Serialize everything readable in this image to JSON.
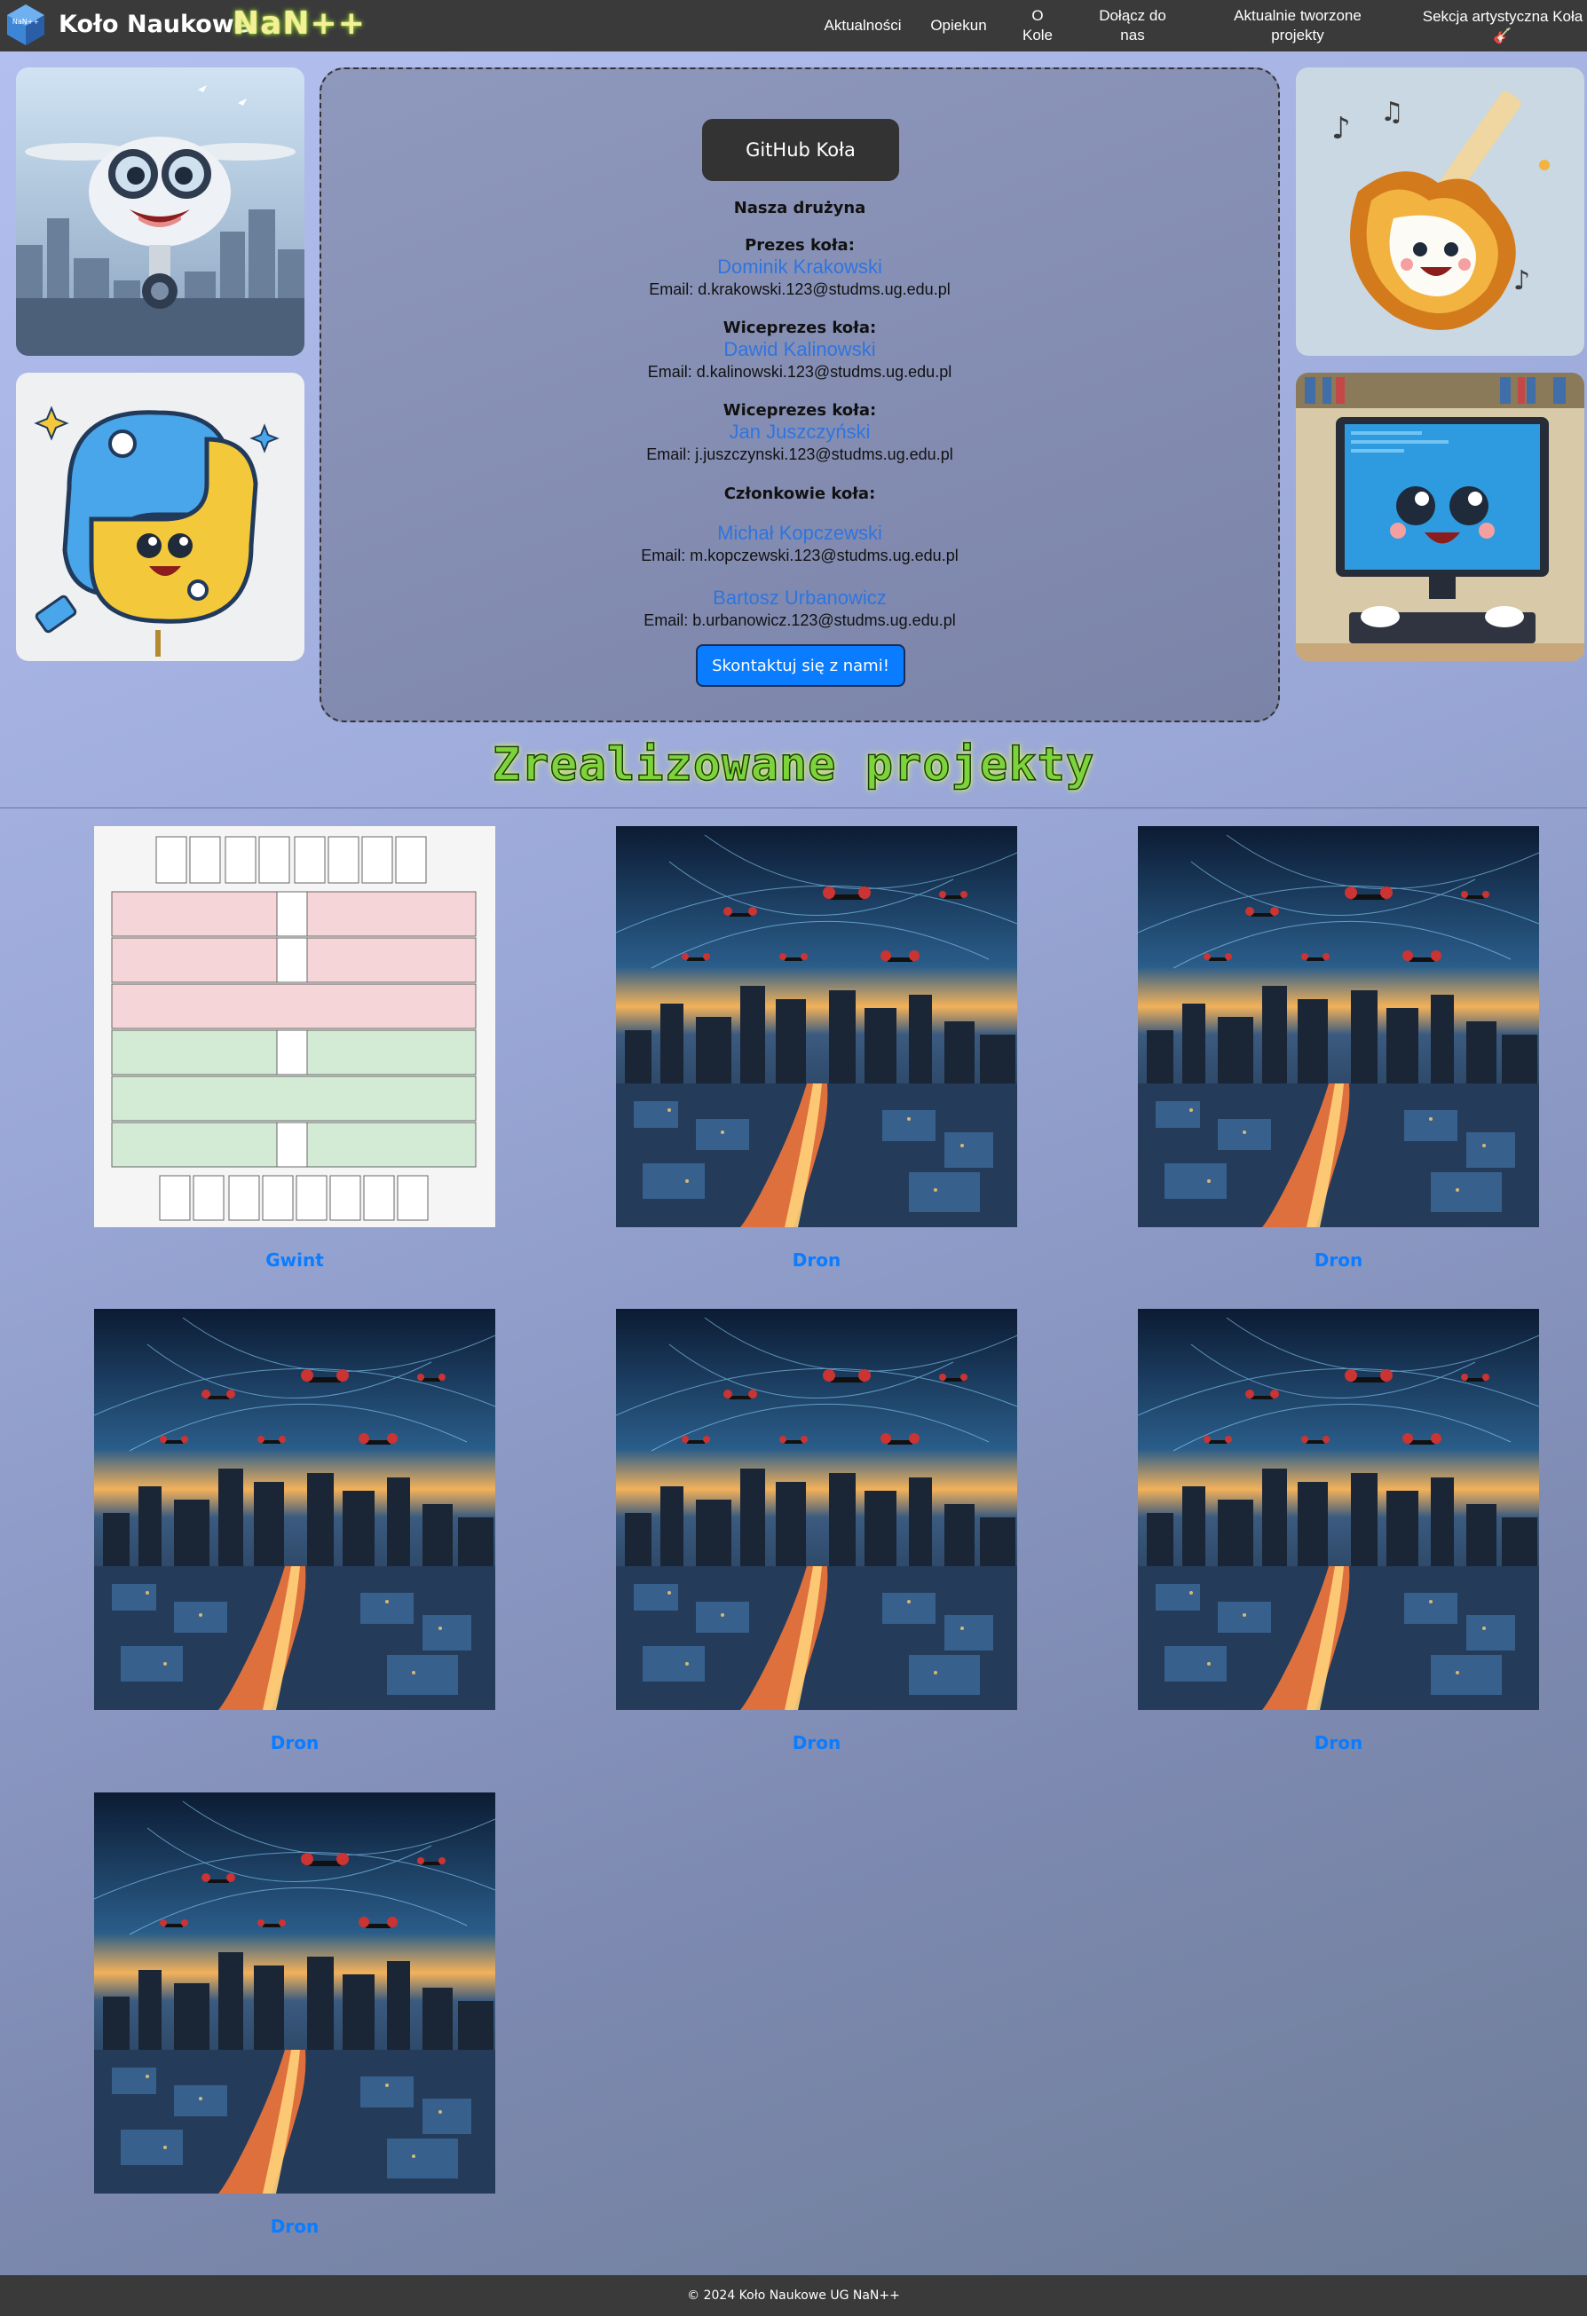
{
  "header": {
    "brand": "Koło Naukowe",
    "brand_accent": "NaN++",
    "logo_text": "NaN++",
    "nav": [
      {
        "label": "Aktualności"
      },
      {
        "label": "Opiekun"
      },
      {
        "label": "O\nKole"
      },
      {
        "label": "Dołącz do\nnas"
      },
      {
        "label": "Aktualnie tworzone\nprojekty"
      },
      {
        "label": "Sekcja artystyczna Koła 🎸"
      }
    ]
  },
  "team": {
    "github_label": "GitHub Koła",
    "section_title": "Nasza drużyna",
    "president_label": "Prezes koła:",
    "president_name": "Dominik Krakowski",
    "president_email": "Email: d.krakowski.123@studms.ug.edu.pl",
    "vp1_label": "Wiceprezes koła:",
    "vp1_name": "Dawid Kalinowski",
    "vp1_email": "Email: d.kalinowski.123@studms.ug.edu.pl",
    "vp2_label": "Wiceprezes koła:",
    "vp2_name": "Jan Juszczyński",
    "vp2_email": "Email: j.juszczynski.123@studms.ug.edu.pl",
    "members_label": "Członkowie koła:",
    "member1_name": "Michał Kopczewski",
    "member1_email": "Email: m.kopczewski.123@studms.ug.edu.pl",
    "member2_name": "Bartosz Urbanowicz",
    "member2_email": "Email: b.urbanowicz.123@studms.ug.edu.pl",
    "contact_label": "Skontaktuj się z nami!"
  },
  "projects": {
    "title": "Zrealizowane projekty",
    "items": [
      {
        "label": "Gwint",
        "image": "gwint-board-image"
      },
      {
        "label": "Dron",
        "image": "drone-city-image"
      },
      {
        "label": "Dron",
        "image": "drone-city-image"
      },
      {
        "label": "Dron",
        "image": "drone-city-image"
      },
      {
        "label": "Dron",
        "image": "drone-city-image"
      },
      {
        "label": "Dron",
        "image": "drone-city-image"
      },
      {
        "label": "Dron",
        "image": "drone-city-image"
      }
    ]
  },
  "side_images": [
    "drone-mascot-image",
    "python-mascot-image",
    "guitar-mascot-image",
    "computer-mascot-image"
  ],
  "footer": {
    "copyright": "© 2024 Koło Naukowe UG NaN++"
  },
  "colors": {
    "header_bg": "#3a3a3a",
    "link_blue": "#0a7cff",
    "accent_green": "#7dd43a",
    "brand_yellow": "#f5ef9a"
  }
}
